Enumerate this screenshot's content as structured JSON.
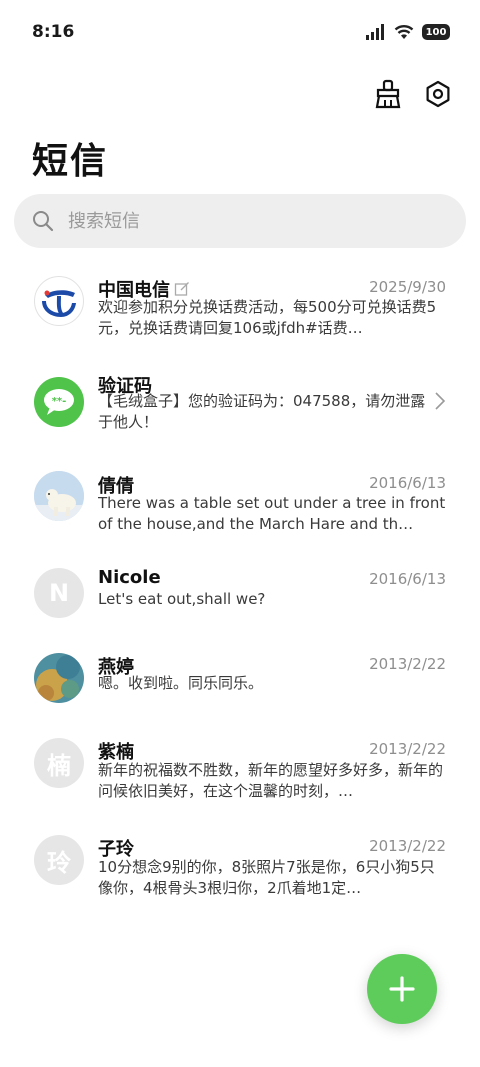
{
  "status_bar": {
    "time": "8:16",
    "battery": "100"
  },
  "header": {
    "title": "短信",
    "clean_icon": "broom-icon",
    "settings_icon": "hexagon-settings-icon"
  },
  "search": {
    "placeholder": "搜索短信"
  },
  "messages": [
    {
      "name": "中国电信",
      "date": "2025/9/30",
      "preview": "欢迎参加积分兑换话费活动，每500分可兑换话费5元，兑换话费请回复106或jfdh#话费…",
      "avatar": "china-telecom-logo"
    },
    {
      "name": "验证码",
      "date": "",
      "preview": "【毛绒盒子】您的验证码为：047588，请勿泄露于他人！",
      "avatar": "message-bubble"
    },
    {
      "name": "倩倩",
      "date": "2016/6/13",
      "preview": "There was a table set out under a tree in front of the house,and the March Hare and th…",
      "avatar": "polar-bear-photo"
    },
    {
      "name": "Nicole",
      "date": "2016/6/13",
      "preview": "Let's eat out,shall we?",
      "avatar_letter": "N"
    },
    {
      "name": "燕婷",
      "date": "2013/2/22",
      "preview": "嗯。收到啦。同乐同乐。",
      "avatar": "colorful-photo"
    },
    {
      "name": "紫楠",
      "date": "2013/2/22",
      "preview": "新年的祝福数不胜数，新年的愿望好多好多，新年的问候依旧美好，在这个温馨的时刻，…",
      "avatar_letter": "楠"
    },
    {
      "name": "子玲",
      "date": "2013/2/22",
      "preview": "10分想念9别的你，8张照片7张是你，6只小狗5只像你，4根骨头3根归你，2爪着地1定…",
      "avatar_letter": "玲"
    }
  ],
  "fab": {
    "icon": "plus-icon"
  },
  "colors": {
    "accent": "#5dcc5a",
    "telecom_blue": "#1b4aa8",
    "avatar_gray": "#e6e6e6"
  }
}
